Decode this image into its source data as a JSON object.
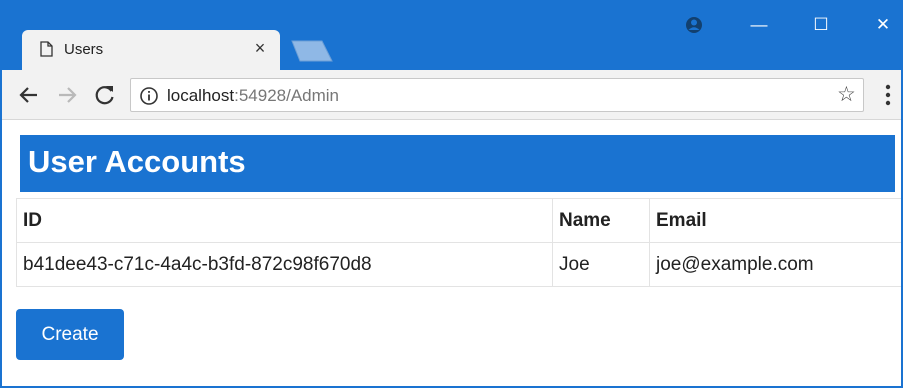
{
  "browser": {
    "tab_title": "Users",
    "tab_close": "×",
    "url_host": "localhost",
    "url_rest": ":54928/Admin",
    "window_controls": {
      "minimize": "—",
      "maximize": "☐",
      "close": "✕"
    },
    "icons": {
      "back": "back-arrow-icon",
      "forward": "forward-arrow-icon",
      "reload": "reload-icon",
      "info": "info-icon",
      "star": "star-icon",
      "menu": "kebab-menu-icon",
      "profile": "profile-icon"
    }
  },
  "page": {
    "heading": "User Accounts",
    "table": {
      "headers": [
        "ID",
        "Name",
        "Email"
      ],
      "rows": [
        [
          "b41dee43-c71c-4a4c-b3fd-872c98f670d8",
          "Joe",
          "joe@example.com"
        ]
      ]
    },
    "create_label": "Create"
  },
  "colors": {
    "accent": "#1a73d1",
    "chrome": "#f2f2f2"
  }
}
